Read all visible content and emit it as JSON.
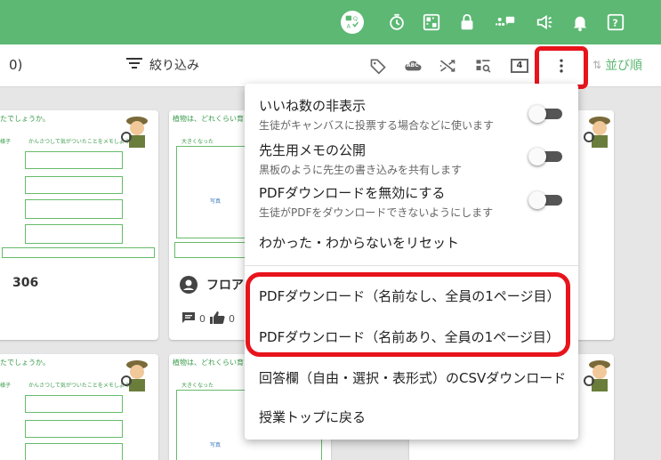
{
  "colors": {
    "accent": "#5cb873",
    "highlight": "#e8141c"
  },
  "topbar": {
    "icons": [
      "quiz-icon",
      "timer-icon",
      "qr-code-icon",
      "lock-icon",
      "group-chat-icon",
      "announcement-icon",
      "bell-icon",
      "help-icon"
    ]
  },
  "toolbar": {
    "count_fragment": "0)",
    "filter_label": "絞り込み",
    "abc_badge": "ABC",
    "column_count": "4",
    "sort_label": "並び順",
    "icons": [
      "tag-icon",
      "spellcheck-cloud-icon",
      "shuffle-icon",
      "view-grid-icon",
      "columns-icon",
      "more-vertical-icon"
    ]
  },
  "cards": [
    {
      "title": "たでしょうか。",
      "subtitle_a": "かんさつして気がついたことをメモしよう。",
      "subtitle_b": "様子"
    },
    {
      "title": "植物は、どれくらい育っ",
      "subtitle_a": "大きくなった",
      "photo": "写真",
      "author": "フロア",
      "author_name_id": "306",
      "comments": "0",
      "likes": "0"
    },
    {
      "title": "たでしょうか。",
      "subtitle_a": "かんさつして気がついたことをメモしよう。",
      "subtitle_b": "様子"
    },
    {
      "title": "植物は、どれくらい育っ",
      "subtitle_a": "大きくなった",
      "photo": "写真"
    }
  ],
  "card_number": "306",
  "menu": {
    "items": [
      {
        "title": "いいね数の非表示",
        "desc": "生徒がキャンバスに投票する場合などに使います",
        "toggle": false
      },
      {
        "title": "先生用メモの公開",
        "desc": "黒板のように先生の書き込みを共有します",
        "toggle": false
      },
      {
        "title": "PDFダウンロードを無効にする",
        "desc": "生徒がPDFをダウンロードできないようにします",
        "toggle": false
      },
      {
        "title": "わかった・わからないをリセット"
      },
      {
        "title": "PDFダウンロード（名前なし、全員の1ページ目）"
      },
      {
        "title": "PDFダウンロード（名前あり、全員の1ページ目）"
      },
      {
        "title": "回答欄（自由・選択・表形式）のCSVダウンロード"
      },
      {
        "title": "授業トップに戻る"
      }
    ]
  }
}
